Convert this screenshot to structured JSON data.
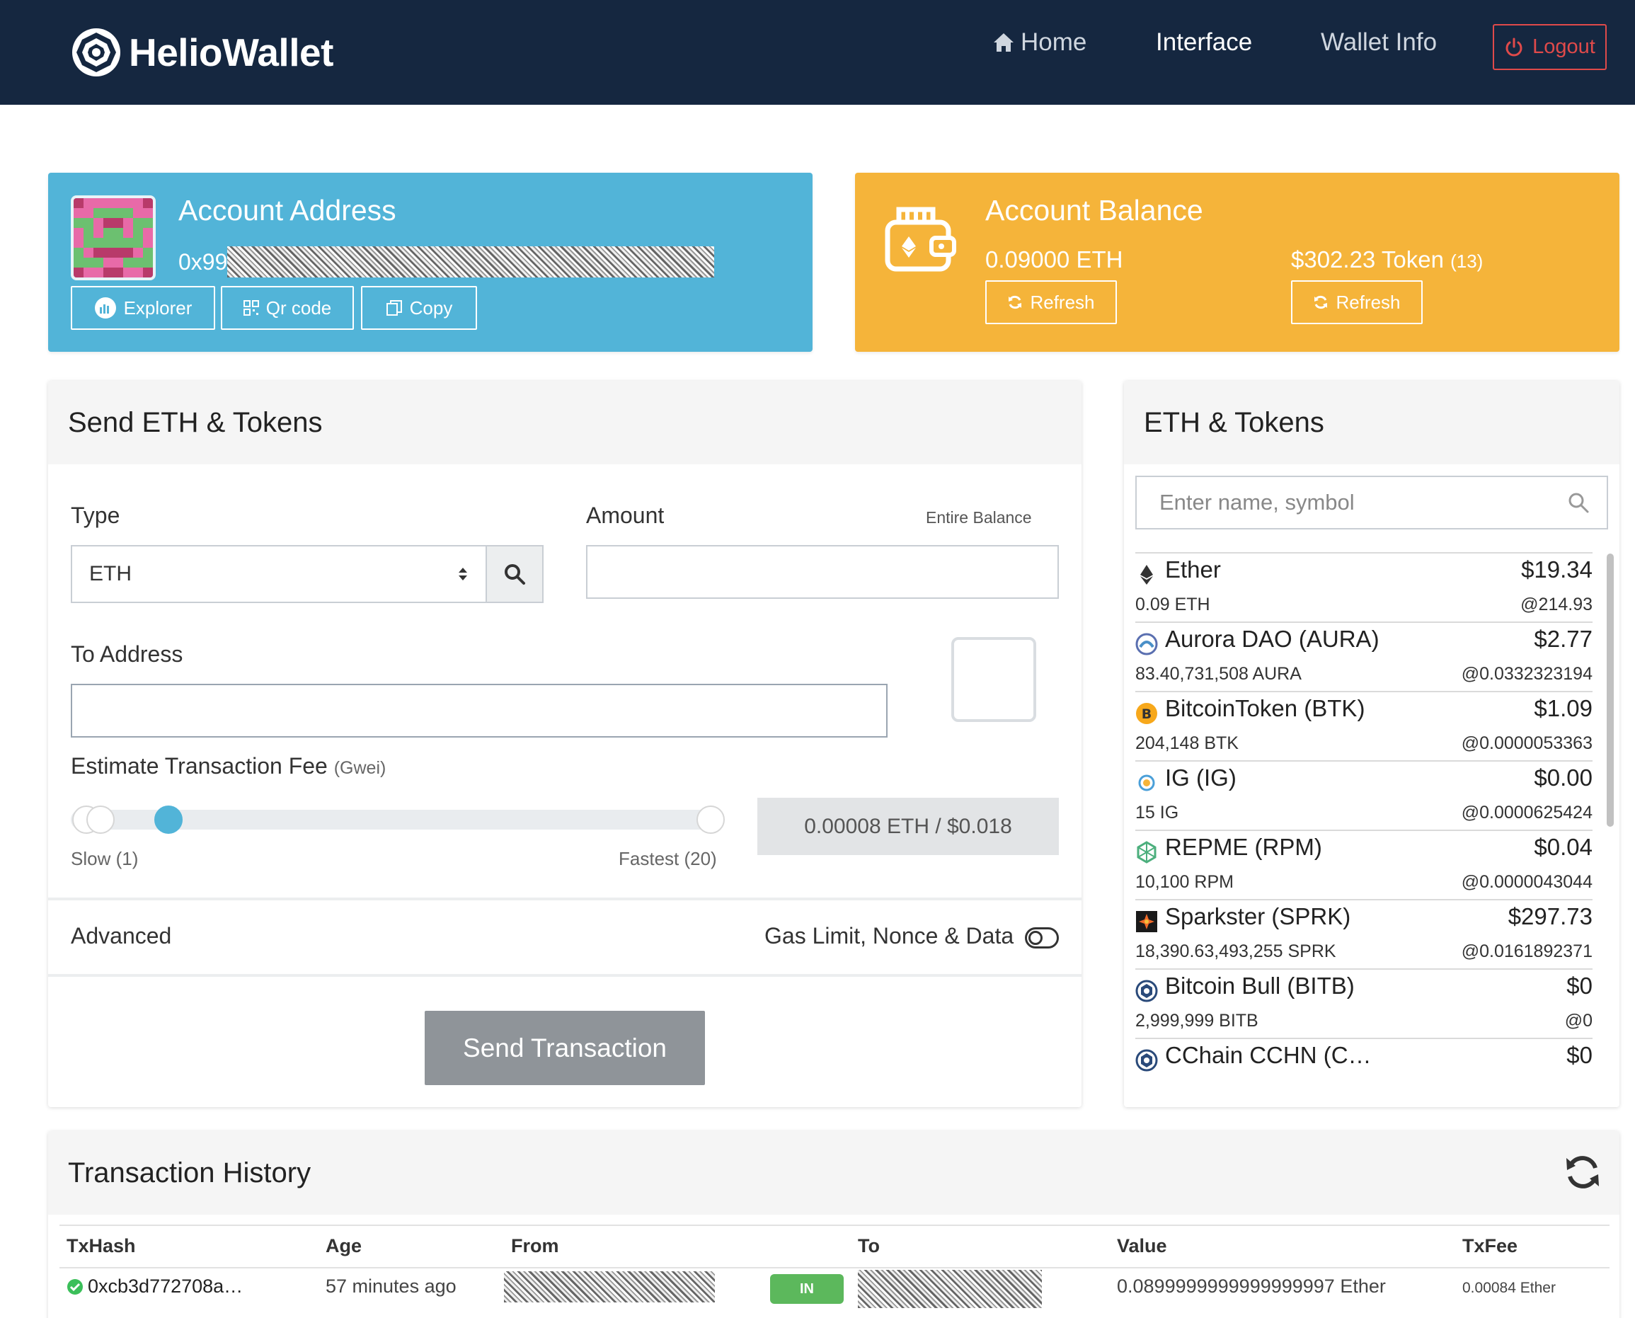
{
  "nav": {
    "brand": "HelioWallet",
    "home": "Home",
    "interface": "Interface",
    "wallet_info": "Wallet Info",
    "logout": "Logout"
  },
  "account": {
    "title": "Account Address",
    "address_prefix": "0x99",
    "explorer": "Explorer",
    "qr_code": "Qr code",
    "copy": "Copy"
  },
  "balance": {
    "title": "Account Balance",
    "eth": "0.09000 ETH",
    "token_value": "$302.23 Token",
    "token_count": "(13)",
    "refresh": "Refresh"
  },
  "send": {
    "title": "Send ETH & Tokens",
    "type_label": "Type",
    "type_value": "ETH",
    "amount_label": "Amount",
    "entire_balance": "Entire Balance",
    "to_address_label": "To Address",
    "fee_label": "Estimate Transaction Fee",
    "fee_unit": "(Gwei)",
    "slow": "Slow (1)",
    "fastest": "Fastest (20)",
    "fee_estimate": "0.00008 ETH / $0.018",
    "advanced": "Advanced",
    "advanced_toggle_label": "Gas Limit, Nonce & Data",
    "send_button": "Send Transaction"
  },
  "tokens": {
    "title": "ETH & Tokens",
    "search_placeholder": "Enter name, symbol",
    "items": [
      {
        "name": "Ether",
        "value": "$19.34",
        "balance": "0.09 ETH",
        "rate": "@214.93"
      },
      {
        "name": "Aurora DAO (AURA)",
        "value": "$2.77",
        "balance": "83.40,731,508 AURA",
        "rate": "@0.0332323194"
      },
      {
        "name": "BitcoinToken (BTK)",
        "value": "$1.09",
        "balance": "204,148 BTK",
        "rate": "@0.0000053363"
      },
      {
        "name": "IG (IG)",
        "value": "$0.00",
        "balance": "15 IG",
        "rate": "@0.0000625424"
      },
      {
        "name": "REPME (RPM)",
        "value": "$0.04",
        "balance": "10,100 RPM",
        "rate": "@0.0000043044"
      },
      {
        "name": "Sparkster (SPRK)",
        "value": "$297.73",
        "balance": "18,390.63,493,255 SPRK",
        "rate": "@0.0161892371"
      },
      {
        "name": "Bitcoin Bull (BITB)",
        "value": "$0",
        "balance": "2,999,999 BITB",
        "rate": "@0"
      },
      {
        "name": "CChain CCHN (C…",
        "value": "$0",
        "balance": "",
        "rate": ""
      }
    ]
  },
  "history": {
    "title": "Transaction History",
    "headers": [
      "TxHash",
      "Age",
      "From",
      "To",
      "Value",
      "TxFee"
    ],
    "rows": [
      {
        "hash": "0xcb3d772708a…",
        "age": "57 minutes ago",
        "direction": "IN",
        "value": "0.0899999999999999997 Ether",
        "fee": "0.00084 Ether"
      }
    ]
  },
  "colors": {
    "navbar": "#152740",
    "account_card": "#52b4d8",
    "balance_card": "#f5b43a",
    "logout": "#e04a4a",
    "in_badge": "#5cb85c",
    "send_button": "#8f9499"
  }
}
